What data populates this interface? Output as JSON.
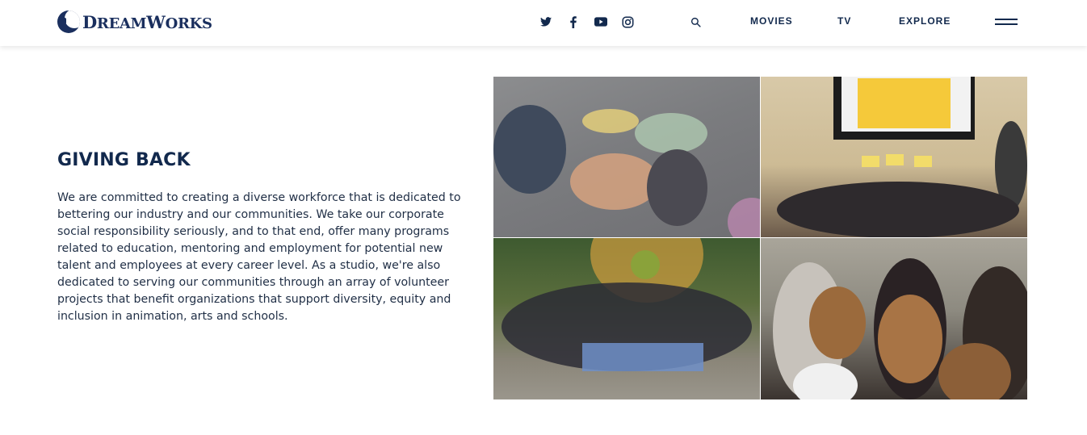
{
  "header": {
    "logo_text": "DreamWorks",
    "social_icons": [
      "twitter-icon",
      "facebook-icon",
      "youtube-icon",
      "instagram-icon"
    ],
    "search_icon": "search-icon",
    "nav": [
      {
        "label": "MOVIES"
      },
      {
        "label": "TV"
      },
      {
        "label": "EXPLORE"
      }
    ],
    "menu_icon": "hamburger-menu-icon"
  },
  "section": {
    "title": "GIVING BACK",
    "body": "We are committed to creating a diverse workforce that is dedicated to bettering our industry and our communities. We take our corporate social responsibility seriously, and to that end, offer many programs related to education, mentoring and employment for potential new talent and employees at every career level. As a studio, we're also dedicated to serving our communities through an array of volunteer projects that benefit organizations that support diversity, equity and inclusion in animation, arts and schools."
  },
  "colors": {
    "brand_navy": "#12294d",
    "header_bg": "#ffffff",
    "page_bg": "#ffffff"
  }
}
